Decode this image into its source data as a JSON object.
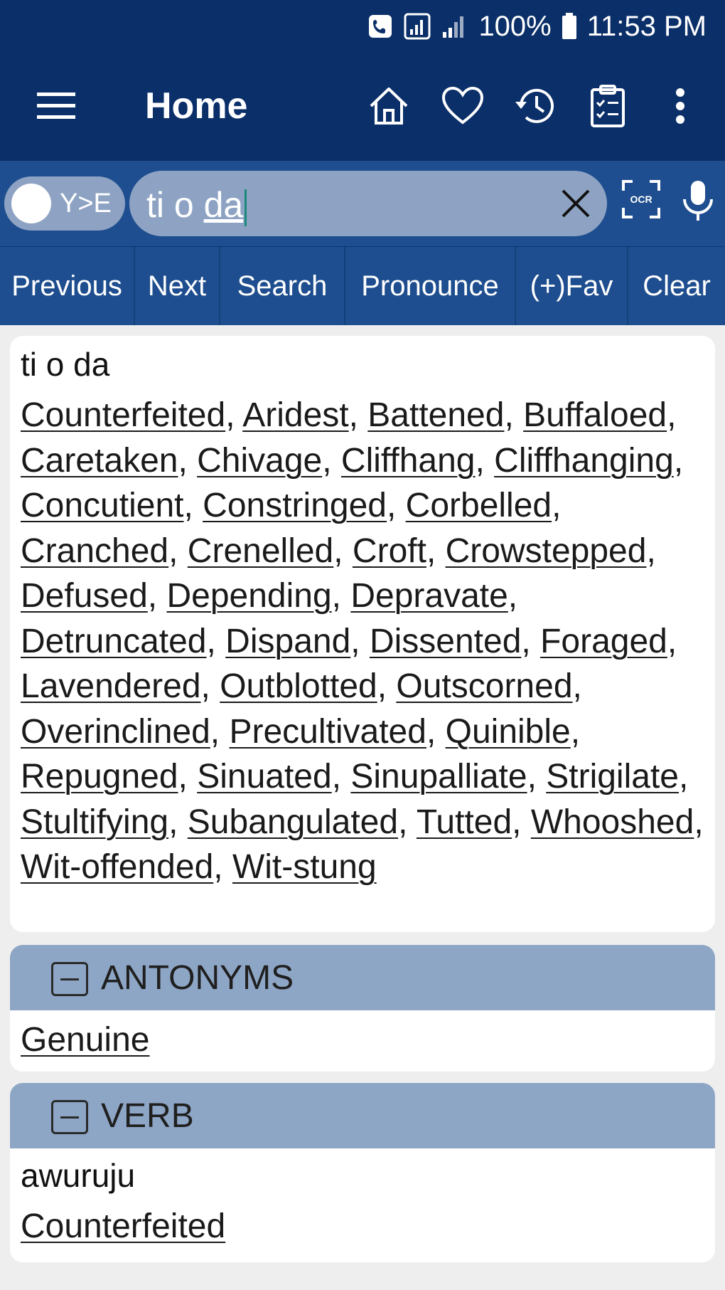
{
  "status_bar": {
    "battery": "100%",
    "time": "11:53 PM",
    "icons": [
      "phone-call-icon",
      "wifi-calling-icon",
      "signal-icon",
      "battery-icon"
    ]
  },
  "app_bar": {
    "title": "Home",
    "actions": [
      "home-icon",
      "heart-icon",
      "history-icon",
      "clipboard-icon",
      "more-vert-icon"
    ]
  },
  "search": {
    "toggle_label": "Y>E",
    "query_plain": "ti o ",
    "query_underlined": "da"
  },
  "toolbar": {
    "buttons": [
      "Previous",
      "Next",
      "Search",
      "Pronounce",
      "(+)Fav",
      "Clear"
    ]
  },
  "entry": {
    "headword": "ti o da",
    "synonyms": [
      "Counterfeited",
      "Aridest",
      "Battened",
      "Buffaloed",
      "Caretaken",
      "Chivage",
      "Cliffhang",
      "Cliffhanging",
      "Concutient",
      "Constringed",
      "Corbelled",
      "Cranched",
      "Crenelled",
      "Croft",
      "Crowstepped",
      "Defused",
      "Depending",
      "Depravate",
      "Detruncated",
      "Dispand",
      "Dissented",
      "Foraged",
      "Lavendered",
      "Outblotted",
      "Outscorned",
      "Overinclined",
      "Precultivated",
      "Quinible",
      "Repugned",
      "Sinuated",
      "Sinupalliate",
      "Strigilate",
      "Stultifying",
      "Subangulated",
      "Tutted",
      "Whooshed",
      "Wit-offended",
      "Wit-stung"
    ]
  },
  "antonyms": {
    "title": "ANTONYMS",
    "items": [
      "Genuine"
    ]
  },
  "verb": {
    "title": "VERB",
    "word": "awuruju",
    "items": [
      "Counterfeited"
    ]
  },
  "colors": {
    "app_bar": "#0b2f69",
    "search_bar": "#1e4e8f",
    "section_header": "#8ea6c6",
    "background": "#eeeeee"
  }
}
